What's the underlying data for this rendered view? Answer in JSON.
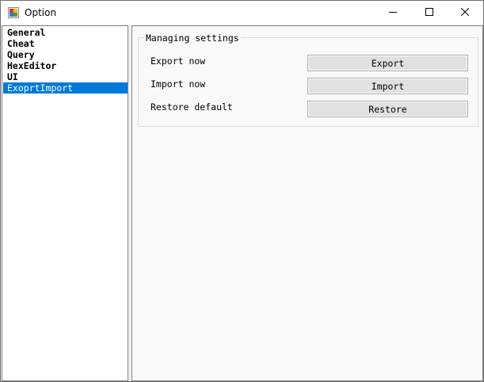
{
  "window": {
    "title": "Option",
    "controls": {
      "minimize_icon": "minimize-icon",
      "maximize_icon": "maximize-icon",
      "close_icon": "close-icon"
    }
  },
  "sidebar": {
    "items": [
      {
        "label": "General",
        "selected": false
      },
      {
        "label": "Cheat",
        "selected": false
      },
      {
        "label": "Query",
        "selected": false
      },
      {
        "label": "HexEditor",
        "selected": false
      },
      {
        "label": "UI",
        "selected": false
      },
      {
        "label": "ExoprtImport",
        "selected": true
      }
    ],
    "selected_color": "#0078d7"
  },
  "panel": {
    "group_title": "Managing settings",
    "rows": [
      {
        "label": "Export now",
        "button": "Export"
      },
      {
        "label": "Import now",
        "button": "Import"
      },
      {
        "label": "Restore default",
        "button": "Restore"
      }
    ]
  }
}
